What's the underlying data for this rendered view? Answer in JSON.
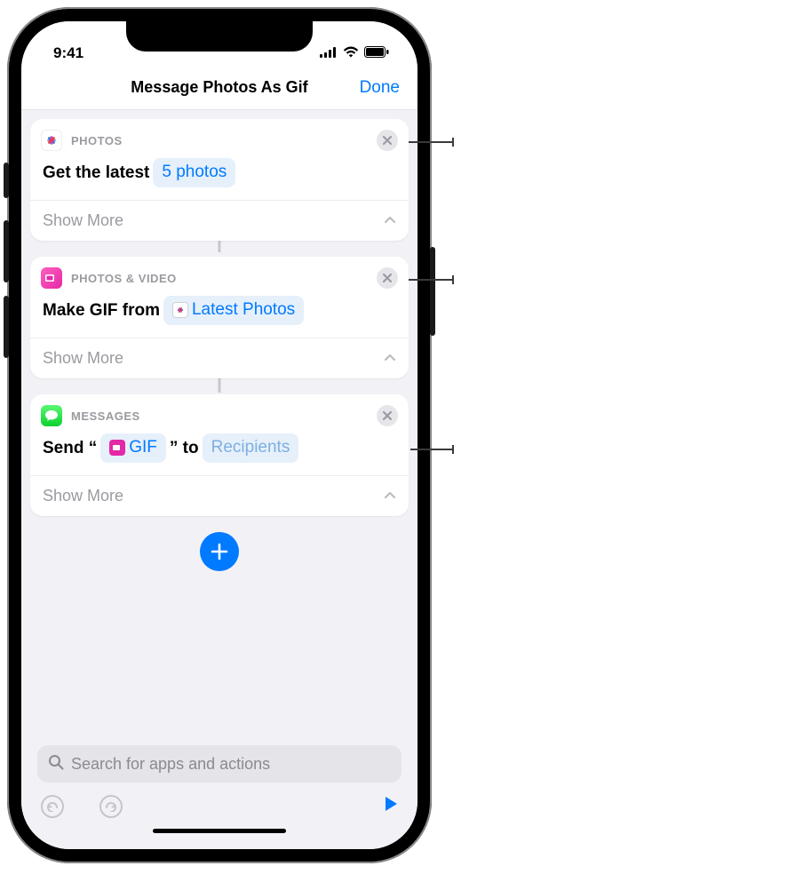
{
  "status": {
    "time": "9:41"
  },
  "nav": {
    "title": "Message Photos As Gif",
    "done": "Done"
  },
  "actions": [
    {
      "app": "PHOTOS",
      "icon": "photos",
      "body_prefix": "Get the latest",
      "token": "5 photos",
      "show_more": "Show More"
    },
    {
      "app": "PHOTOS & VIDEO",
      "icon": "photosvideo",
      "body_prefix": "Make GIF from",
      "token": "Latest Photos",
      "token_has_chip": true,
      "show_more": "Show More"
    },
    {
      "app": "MESSAGES",
      "icon": "messages",
      "body_prefix": "Send “",
      "body_mid_token": "GIF",
      "body_mid_has_chip": true,
      "body_mid_after": "” to",
      "token": "Recipients",
      "token_faded": true,
      "show_more": "Show More"
    }
  ],
  "search": {
    "placeholder": "Search for apps and actions"
  }
}
